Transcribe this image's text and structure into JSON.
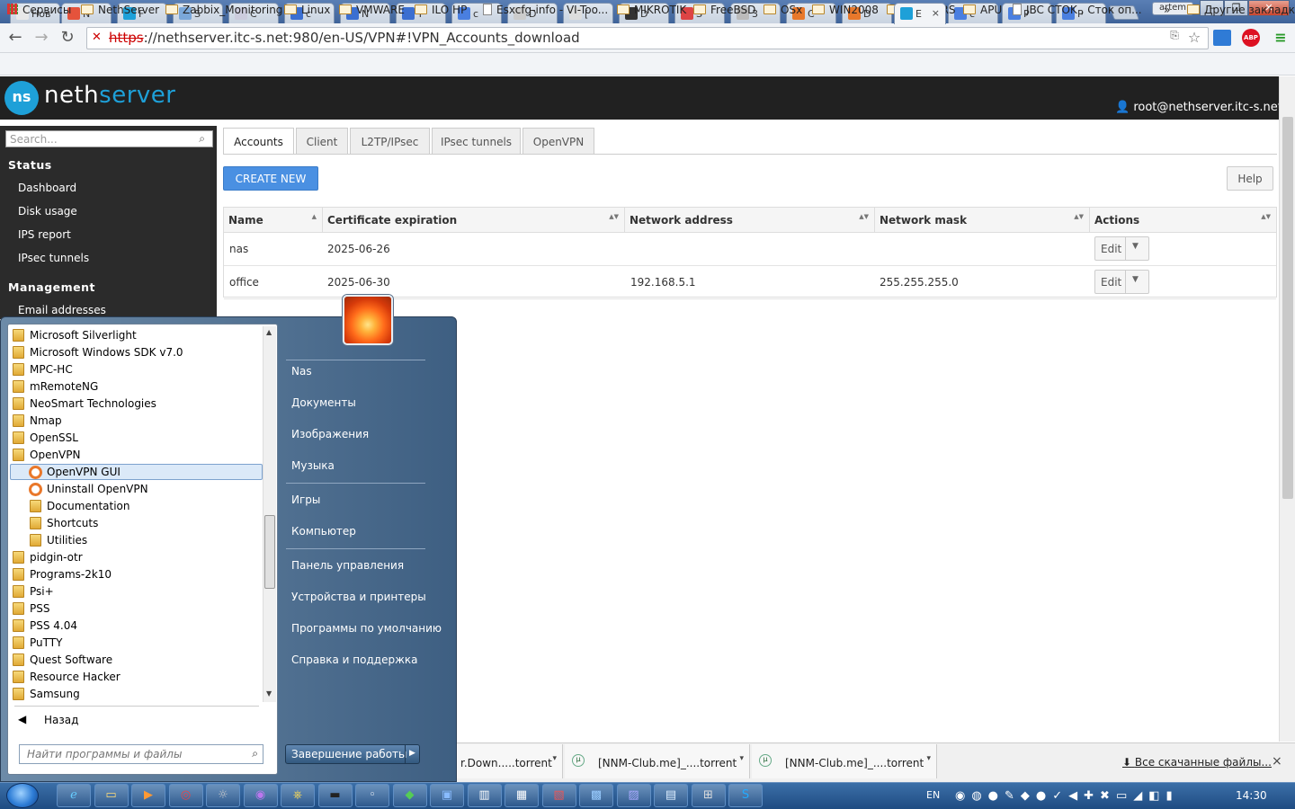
{
  "browser": {
    "tabs": [
      {
        "label": "Нов",
        "fav": "#e8e8e8"
      },
      {
        "label": "N",
        "fav": "#e5533c"
      },
      {
        "label": "F",
        "fav": "#1ea0d8"
      },
      {
        "label": "S",
        "fav": "#7aa7d9"
      },
      {
        "label": "C",
        "fav": "#ccd"
      },
      {
        "label": "c",
        "fav": "#3b6fd1"
      },
      {
        "label": "N",
        "fav": "#3b6fd1"
      },
      {
        "label": "T",
        "fav": "#3b6fd1"
      },
      {
        "label": "c",
        "fav": "#4a7fe0"
      },
      {
        "label": "D",
        "fav": "#ccc"
      },
      {
        "label": "[",
        "fav": "#ddd"
      },
      {
        "label": "D",
        "fav": "#333"
      },
      {
        "label": "S",
        "fav": "#d44"
      },
      {
        "label": "3",
        "fav": "#bbb"
      },
      {
        "label": "C",
        "fav": "#e8782b"
      },
      {
        "label": "D",
        "fav": "#e8782b"
      },
      {
        "label": "E",
        "fav": "#1ea0d8"
      },
      {
        "label": "c",
        "fav": "#4a7fe0"
      },
      {
        "label": "P",
        "fav": "#4a7fe0"
      },
      {
        "label": "P",
        "fav": "#4a7fe0"
      }
    ],
    "active_tab_close": "×",
    "profile": "artem",
    "win_min": "–",
    "win_max": "❐",
    "win_close": "✕",
    "nav": {
      "back": "←",
      "forward": "→",
      "reload": "↻"
    },
    "url_scheme": "https",
    "url_rest": "://nethserver.itc-s.net:980/en-US/VPN#!VPN_Accounts_download",
    "star": "☆",
    "menu": "≡",
    "abp": "ABP",
    "bookmarks": [
      {
        "label": "Сервисы",
        "kind": "apps"
      },
      {
        "label": "NethServer",
        "kind": "folder"
      },
      {
        "label": "Zabbix_Monitoring",
        "kind": "folder"
      },
      {
        "label": "Linux",
        "kind": "folder"
      },
      {
        "label": "VMWARE",
        "kind": "folder"
      },
      {
        "label": "ILO HP",
        "kind": "folder"
      },
      {
        "label": "Esxcfg-info - VI-Too...",
        "kind": "page"
      },
      {
        "label": "MIKROTIK",
        "kind": "folder"
      },
      {
        "label": "FreeBSD",
        "kind": "folder"
      },
      {
        "label": "OSx",
        "kind": "folder"
      },
      {
        "label": "WIN2008",
        "kind": "folder"
      },
      {
        "label": "ROUTERS",
        "kind": "folder"
      },
      {
        "label": "APU",
        "kind": "folder"
      },
      {
        "label": "JBC CTOK , Сток оп...",
        "kind": "page"
      }
    ],
    "bookmarks_more": "»",
    "other_bookmarks": "Другие закладки"
  },
  "app": {
    "logo_mark": "ns",
    "logo_a": "neth",
    "logo_b": "server",
    "user": "root@nethserver.itc-s.net",
    "search_placeholder": "Search...",
    "sidebar": {
      "status_heading": "Status",
      "status_items": [
        "Dashboard",
        "Disk usage",
        "IPS report",
        "IPsec tunnels"
      ],
      "management_heading": "Management",
      "management_items": [
        "Email addresses"
      ]
    },
    "tabs": [
      "Accounts",
      "Client",
      "L2TP/IPsec",
      "IPsec tunnels",
      "OpenVPN"
    ],
    "create_button": "CREATE NEW",
    "help_button": "Help",
    "table": {
      "columns": [
        "Name",
        "Certificate expiration",
        "Network address",
        "Network mask",
        "Actions"
      ],
      "rows": [
        {
          "name": "nas",
          "expiry": "2025-06-26",
          "network": "",
          "mask": "",
          "action": "Edit"
        },
        {
          "name": "office",
          "expiry": "2025-06-30",
          "network": "192.168.5.1",
          "mask": "255.255.255.0",
          "action": "Edit"
        }
      ]
    }
  },
  "downloads": {
    "items": [
      {
        "label": "r.Down.....torrent"
      },
      {
        "label": "[NNM-Club.me]_....torrent"
      },
      {
        "label": "[NNM-Club.me]_....torrent"
      }
    ],
    "show_all": "Все скачанные файлы...",
    "close": "×"
  },
  "start_menu": {
    "programs": [
      {
        "label": "Microsoft Silverlight",
        "kind": "folder"
      },
      {
        "label": "Microsoft Windows SDK v7.0",
        "kind": "folder"
      },
      {
        "label": "MPC-HC",
        "kind": "folder"
      },
      {
        "label": "mRemoteNG",
        "kind": "folder"
      },
      {
        "label": "NeoSmart Technologies",
        "kind": "folder"
      },
      {
        "label": "Nmap",
        "kind": "folder"
      },
      {
        "label": "OpenSSL",
        "kind": "folder"
      },
      {
        "label": "OpenVPN",
        "kind": "folder"
      },
      {
        "label": "OpenVPN GUI",
        "kind": "app",
        "sub": true,
        "selected": true
      },
      {
        "label": "Uninstall OpenVPN",
        "kind": "app",
        "sub": true
      },
      {
        "label": "Documentation",
        "kind": "folder",
        "sub": true
      },
      {
        "label": "Shortcuts",
        "kind": "folder",
        "sub": true
      },
      {
        "label": "Utilities",
        "kind": "folder",
        "sub": true
      },
      {
        "label": "pidgin-otr",
        "kind": "folder"
      },
      {
        "label": "Programs-2k10",
        "kind": "folder"
      },
      {
        "label": "Psi+",
        "kind": "folder"
      },
      {
        "label": "PSS",
        "kind": "folder"
      },
      {
        "label": "PSS 4.04",
        "kind": "folder"
      },
      {
        "label": "PuTTY",
        "kind": "folder"
      },
      {
        "label": "Quest Software",
        "kind": "folder"
      },
      {
        "label": "Resource Hacker",
        "kind": "folder"
      },
      {
        "label": "Samsung",
        "kind": "folder"
      }
    ],
    "back": "Назад",
    "search_placeholder": "Найти программы и файлы",
    "right_items": [
      "Nas",
      "Документы",
      "Изображения",
      "Музыка",
      "Игры",
      "Компьютер",
      "Панель управления",
      "Устройства и принтеры",
      "Программы по умолчанию",
      "Справка и поддержка"
    ],
    "shutdown": "Завершение работы"
  },
  "taskbar": {
    "lang": "EN",
    "time": "14:30"
  }
}
